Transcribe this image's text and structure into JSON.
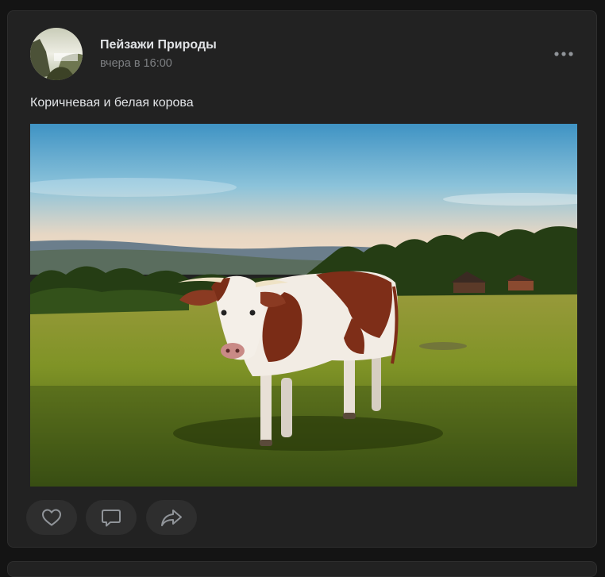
{
  "post": {
    "author": "Пейзажи Природы",
    "time": "вчера в 16:00",
    "text": "Коричневая и белая корова",
    "photo_icon": "cow-photo",
    "avatar_icon": "landscape-avatar",
    "actions": {
      "like_icon": "heart-icon",
      "comment_icon": "comment-icon",
      "share_icon": "share-icon",
      "more_icon": "more-dots-icon"
    }
  },
  "colors": {
    "background": "#141414",
    "card": "#222222",
    "text_primary": "#e1e3e6",
    "text_secondary": "#7e8083",
    "button_bg": "#2e2e2e",
    "icon": "#909499"
  }
}
